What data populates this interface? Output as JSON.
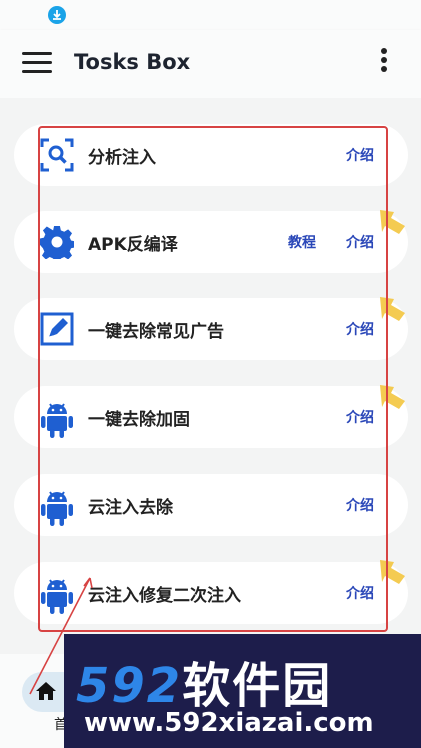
{
  "app": {
    "title": "Tosks Box"
  },
  "list": {
    "items": [
      {
        "title": "分析注入",
        "intro": "介绍",
        "tutorial": null,
        "icon": "scan-search-icon"
      },
      {
        "title": "APK反编译",
        "intro": "介绍",
        "tutorial": "教程",
        "icon": "gear-icon"
      },
      {
        "title": "一键去除常见广告",
        "intro": "介绍",
        "tutorial": null,
        "icon": "edit-box-icon"
      },
      {
        "title": "一键去除加固",
        "intro": "介绍",
        "tutorial": null,
        "icon": "android-icon"
      },
      {
        "title": "云注入去除",
        "intro": "介绍",
        "tutorial": null,
        "icon": "android-icon"
      },
      {
        "title": "云注入修复二次注入",
        "intro": "介绍",
        "tutorial": null,
        "icon": "android-icon"
      }
    ]
  },
  "bottom_nav": {
    "home_label": "首"
  },
  "watermark": {
    "logo_digits": "592",
    "logo_text": "软件园",
    "url": "www.592xiazai.com"
  },
  "colors": {
    "accent": "#2a47b8",
    "icon_blue": "#1f5fd1",
    "annotation_red": "#d74343",
    "arrow_yellow": "#f2c233"
  }
}
